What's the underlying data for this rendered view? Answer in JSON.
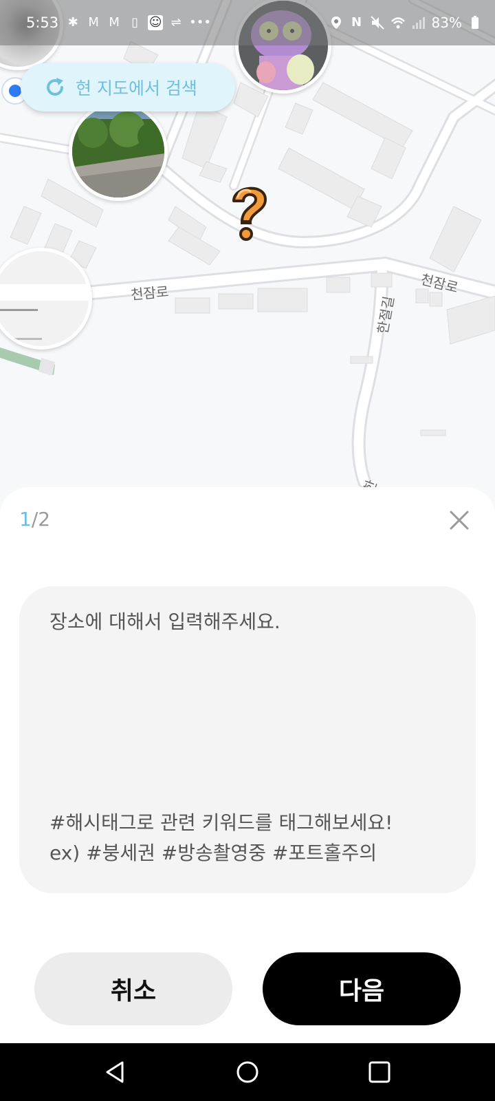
{
  "status_bar": {
    "time": "5:53",
    "battery": "83%",
    "left_icons": [
      "slack-icon",
      "gmail-icon",
      "gmail-icon",
      "notes-icon",
      "app-icon",
      "usb-icon",
      "more-icon"
    ],
    "right_icons": [
      "location-icon",
      "nfc-icon",
      "mute-icon",
      "wifi-icon",
      "signal-icon",
      "battery-icon"
    ]
  },
  "map": {
    "search_here_label": "현 지도에서 검색",
    "road_labels": {
      "west": "천잠로",
      "east": "천잠로",
      "vertical": "한절길",
      "bottom": "한"
    },
    "marker_icon": "question-mark-icon",
    "colors": {
      "background": "#f7f8fa",
      "road": "#ffffff",
      "building": "#e9e9ea",
      "accent": "#6fc0de"
    }
  },
  "sheet": {
    "step_current": "1",
    "step_total": "/2",
    "input_placeholder": "장소에 대해서 입력해주세요.",
    "hint_line1": "#해시태그로 관련 키워드를 태그해보세요!",
    "hint_line2": "ex) #붕세권 #방송촬영중 #포트홀주의",
    "cancel_label": "취소",
    "next_label": "다음"
  },
  "nav_bar": {
    "buttons": [
      "back-icon",
      "home-icon",
      "recents-icon"
    ]
  }
}
